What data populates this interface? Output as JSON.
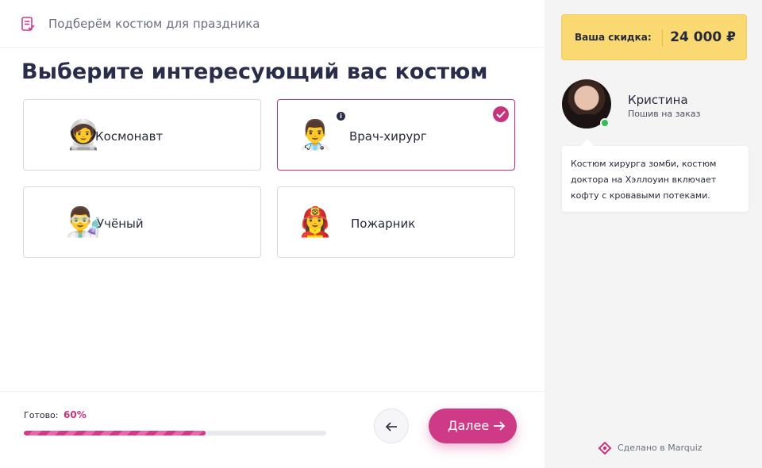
{
  "header": {
    "title": "Подберём костюм для праздника",
    "icon": "checklist-doc-icon"
  },
  "question": {
    "title": "Выберите интересующий вас костюм"
  },
  "options": [
    {
      "label": "Космонавт",
      "emoji": "🧑‍🚀",
      "icon": "astronaut-icon",
      "selected": false
    },
    {
      "label": "Врач-хирург",
      "emoji": "👨‍⚕️",
      "icon": "doctor-icon",
      "selected": true,
      "has_info": true,
      "info_glyph": "i"
    },
    {
      "label": "Учёный",
      "emoji": "👨‍🔬",
      "icon": "scientist-icon",
      "selected": false
    },
    {
      "label": "Пожарник",
      "emoji": "👩‍🚒",
      "icon": "firefighter-icon",
      "selected": false
    }
  ],
  "progress": {
    "caption": "Готово:",
    "value_label": "60%",
    "value": 0.6
  },
  "navigation": {
    "back_icon": "arrow-left-icon",
    "next_label": "Далее",
    "next_icon": "arrow-right-icon"
  },
  "discount": {
    "label": "Ваша скидка:",
    "value": "24 000 ₽"
  },
  "consultant": {
    "name": "Кристина",
    "role": "Пошив на заказ",
    "status": "online",
    "message": "Костюм хирурга зомби, костюм доктора на Хэллоуин включает кофту с кровавыми потеками."
  },
  "footer": {
    "made_in": "Сделано в Marquiz",
    "icon": "marquiz-logo-icon"
  },
  "colors": {
    "accent": "#cf3a86",
    "discount_bg": "#fbd972",
    "sidebar_bg": "#f4f4f5",
    "online": "#2fbf52"
  }
}
